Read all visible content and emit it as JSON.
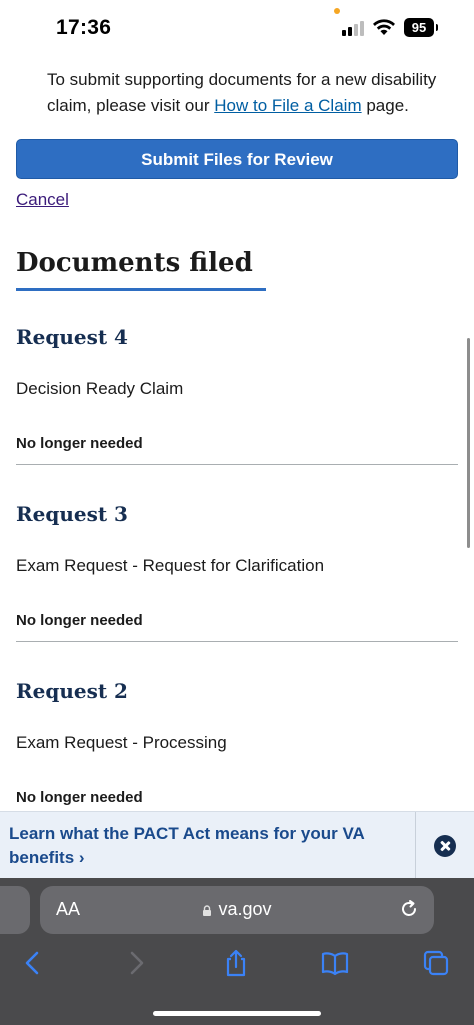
{
  "status_bar": {
    "time": "17:36",
    "battery": "95"
  },
  "intro": {
    "text_before": "To submit supporting documents for a new disability claim, please visit our ",
    "link_label": "How to File a Claim",
    "text_after": " page."
  },
  "actions": {
    "submit_label": "Submit Files for Review",
    "cancel_label": "Cancel"
  },
  "documents": {
    "title": "Documents filed",
    "requests": [
      {
        "title": "Request 4",
        "description": "Decision Ready Claim",
        "status": "No longer needed"
      },
      {
        "title": "Request 3",
        "description": "Exam Request - Request for Clarification",
        "status": "No longer needed"
      },
      {
        "title": "Request 2",
        "description": "Exam Request - Processing",
        "status": "No longer needed"
      }
    ]
  },
  "banner": {
    "text": "Learn what the PACT Act means for your VA benefits",
    "chevron": "›"
  },
  "browser": {
    "text_size_label": "AA",
    "url": "va.gov"
  },
  "colors": {
    "accent": "#2e6ec2",
    "heading": "#162e51",
    "banner_bg": "#eaf0f8",
    "toolbar_bg": "#4a4a4c",
    "toolbar_icon": "#3b82f6"
  },
  "icons": [
    "signal-icon",
    "wifi-icon",
    "battery-icon",
    "close-icon",
    "lock-icon",
    "reload-icon",
    "back-icon",
    "forward-icon",
    "share-icon",
    "bookmarks-icon",
    "tabs-icon"
  ]
}
